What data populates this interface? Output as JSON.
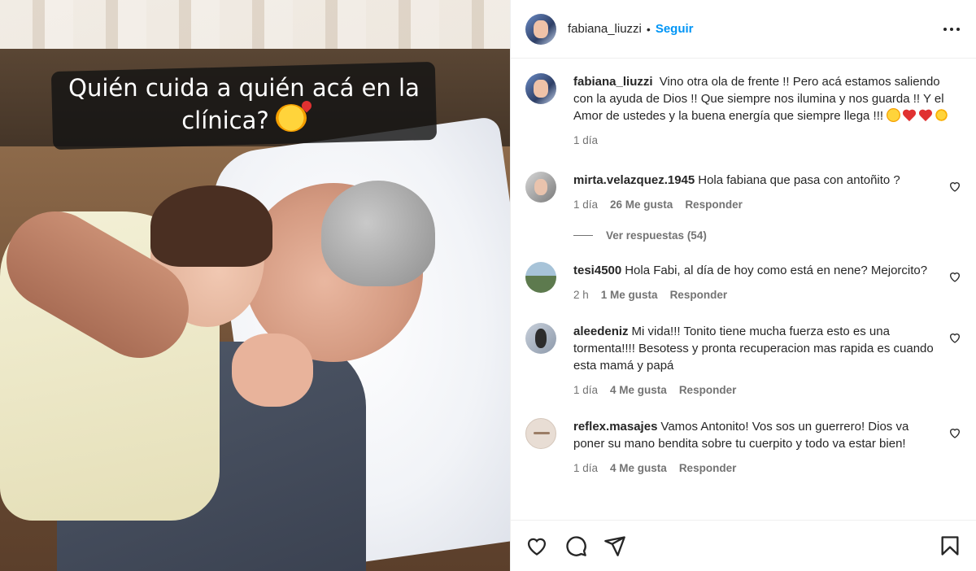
{
  "photo": {
    "overlay_line1": "Quién cuida a quién acá en la",
    "overlay_line2": "clínica?"
  },
  "header": {
    "username": "fabiana_liuzzi",
    "separator": "•",
    "follow_label": "Seguir"
  },
  "caption": {
    "username": "fabiana_liuzzi",
    "text": "Vino otra ola de frente !! Pero acá estamos saliendo con la ayuda de Dios !! Que siempre nos ilumina y nos guarda !! Y el Amor de ustedes y la buena energía que siempre llega !!!",
    "time": "1 día"
  },
  "comments": [
    {
      "username": "mirta.velazquez.1945",
      "text": "Hola fabiana que pasa con antoñito ?",
      "time": "1 día",
      "likes": "26 Me gusta",
      "reply": "Responder"
    },
    {
      "username": "tesi4500",
      "text": "Hola Fabi, al día de hoy como está en nene? Mejorcito?",
      "time": "2 h",
      "likes": "1 Me gusta",
      "reply": "Responder"
    },
    {
      "username": "aleedeniz",
      "text": "Mi vida!!! Tonito tiene mucha fuerza esto es una tormenta!!!! Besotess y pronta recuperacion mas rapida es cuando esta mamá y papá",
      "time": "1 día",
      "likes": "4 Me gusta",
      "reply": "Responder"
    },
    {
      "username": "reflex.masajes",
      "text": "Vamos Antonito! Vos sos un guerrero! Dios va poner su mano bendita sobre tu cuerpito y todo va estar bien!",
      "time": "1 día",
      "likes": "4 Me gusta",
      "reply": "Responder"
    }
  ],
  "view_replies": "Ver respuestas (54)",
  "colors": {
    "accent": "#0095f6",
    "muted": "#737373",
    "text": "#262626"
  },
  "icons": [
    "more-options-icon",
    "heart-icon",
    "comment-icon",
    "share-icon",
    "bookmark-icon"
  ]
}
